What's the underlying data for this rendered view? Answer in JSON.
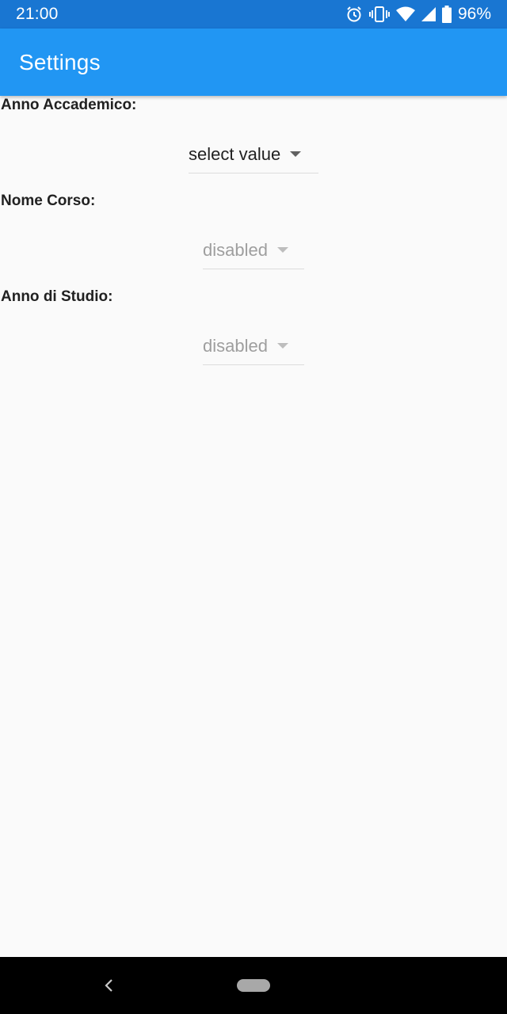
{
  "status_bar": {
    "time": "21:00",
    "battery": "96%",
    "icons": [
      "alarm-icon",
      "vibrate-icon",
      "wifi-icon",
      "signal-icon",
      "battery-icon"
    ]
  },
  "app_bar": {
    "title": "Settings",
    "color": "#2196f3"
  },
  "fields": [
    {
      "label": "Anno Accademico:",
      "value": "select value",
      "enabled": true
    },
    {
      "label": "Nome Corso:",
      "value": "disabled",
      "enabled": false
    },
    {
      "label": "Anno di Studio:",
      "value": "disabled",
      "enabled": false
    }
  ],
  "nav_bar": {
    "icons": [
      "back-icon",
      "home-pill-icon"
    ]
  }
}
